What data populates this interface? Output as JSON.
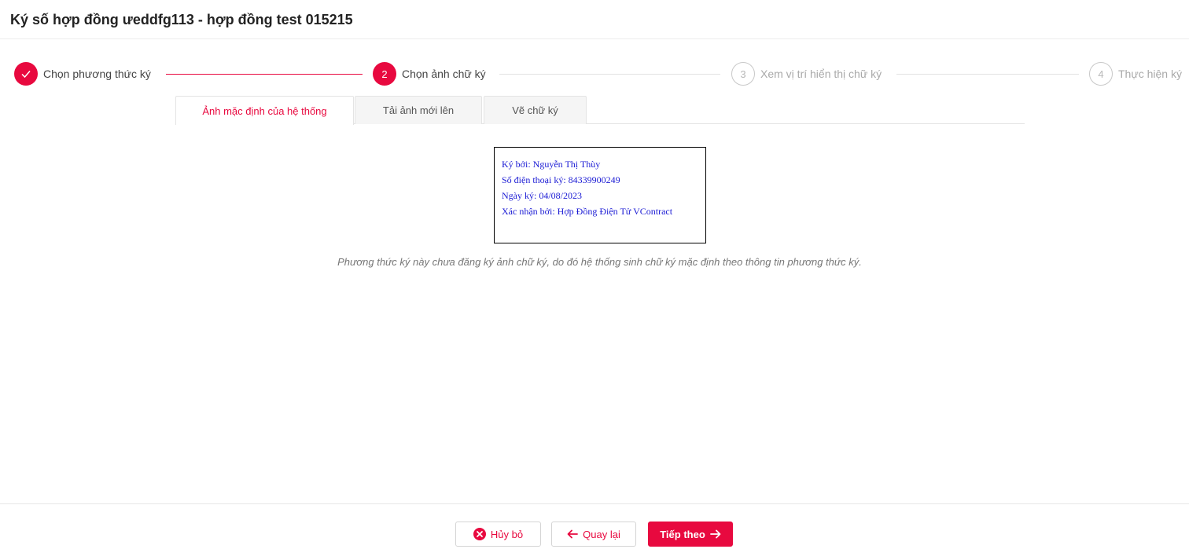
{
  "page": {
    "title": "Ký số hợp đồng ưeddfg113 - hợp đồng test 015215"
  },
  "stepper": {
    "steps": [
      {
        "number": "",
        "label": "Chọn phương thức ký",
        "state": "done",
        "icon": "check-icon"
      },
      {
        "number": "2",
        "label": "Chọn ảnh chữ ký",
        "state": "active"
      },
      {
        "number": "3",
        "label": "Xem vị trí hiển thị chữ ký",
        "state": "pending"
      },
      {
        "number": "4",
        "label": "Thực hiện ký",
        "state": "pending"
      }
    ]
  },
  "tabs": [
    {
      "label": "Ảnh mặc định của hệ thống",
      "active": true
    },
    {
      "label": "Tải ảnh mới lên",
      "active": false
    },
    {
      "label": "Vẽ chữ ký",
      "active": false
    }
  ],
  "signature": {
    "lines": [
      "Ký bởi: Nguyễn Thị Thùy",
      "Số điện thoại ký: 84339900249",
      "Ngày ký: 04/08/2023",
      "Xác nhận bởi: Hợp Đồng Điện Tử VContract"
    ]
  },
  "note": "Phương thức ký này chưa đăng ký ảnh chữ ký, do đó hệ thống sinh chữ ký mặc định theo thông tin phương thức ký.",
  "footer": {
    "cancel_label": "Hủy bỏ",
    "back_label": "Quay lại",
    "next_label": "Tiếp theo"
  },
  "colors": {
    "accent": "#e8093f",
    "signature_text": "#1a1ad4"
  }
}
